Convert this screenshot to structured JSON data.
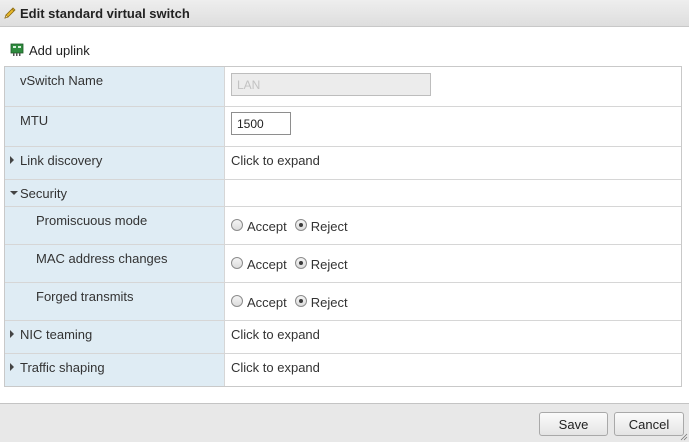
{
  "dialog": {
    "title": "Edit standard virtual switch",
    "title_icon": "pencil-icon"
  },
  "toolbar": {
    "add_uplink_label": "Add uplink",
    "add_uplink_icon": "network-card-icon"
  },
  "props": {
    "vswitch_name": {
      "label": "vSwitch Name",
      "value": "LAN",
      "disabled": true
    },
    "mtu": {
      "label": "MTU",
      "value": "1500"
    },
    "link_discovery": {
      "label": "Link discovery",
      "value": "Click to expand",
      "expanded": false
    },
    "security": {
      "label": "Security",
      "expanded": true,
      "promiscuous": {
        "label": "Promiscuous mode",
        "options": [
          "Accept",
          "Reject"
        ],
        "selected": "Reject"
      },
      "mac_changes": {
        "label": "MAC address changes",
        "options": [
          "Accept",
          "Reject"
        ],
        "selected": "Reject"
      },
      "forged": {
        "label": "Forged transmits",
        "options": [
          "Accept",
          "Reject"
        ],
        "selected": "Reject"
      }
    },
    "nic_teaming": {
      "label": "NIC teaming",
      "value": "Click to expand",
      "expanded": false
    },
    "traffic_shaping": {
      "label": "Traffic shaping",
      "value": "Click to expand",
      "expanded": false
    }
  },
  "footer": {
    "save_label": "Save",
    "cancel_label": "Cancel"
  },
  "colors": {
    "label_column_bg": "#dfecf4",
    "icon_green": "#2e8b3e",
    "pencil_yellow": "#e8b82a"
  }
}
